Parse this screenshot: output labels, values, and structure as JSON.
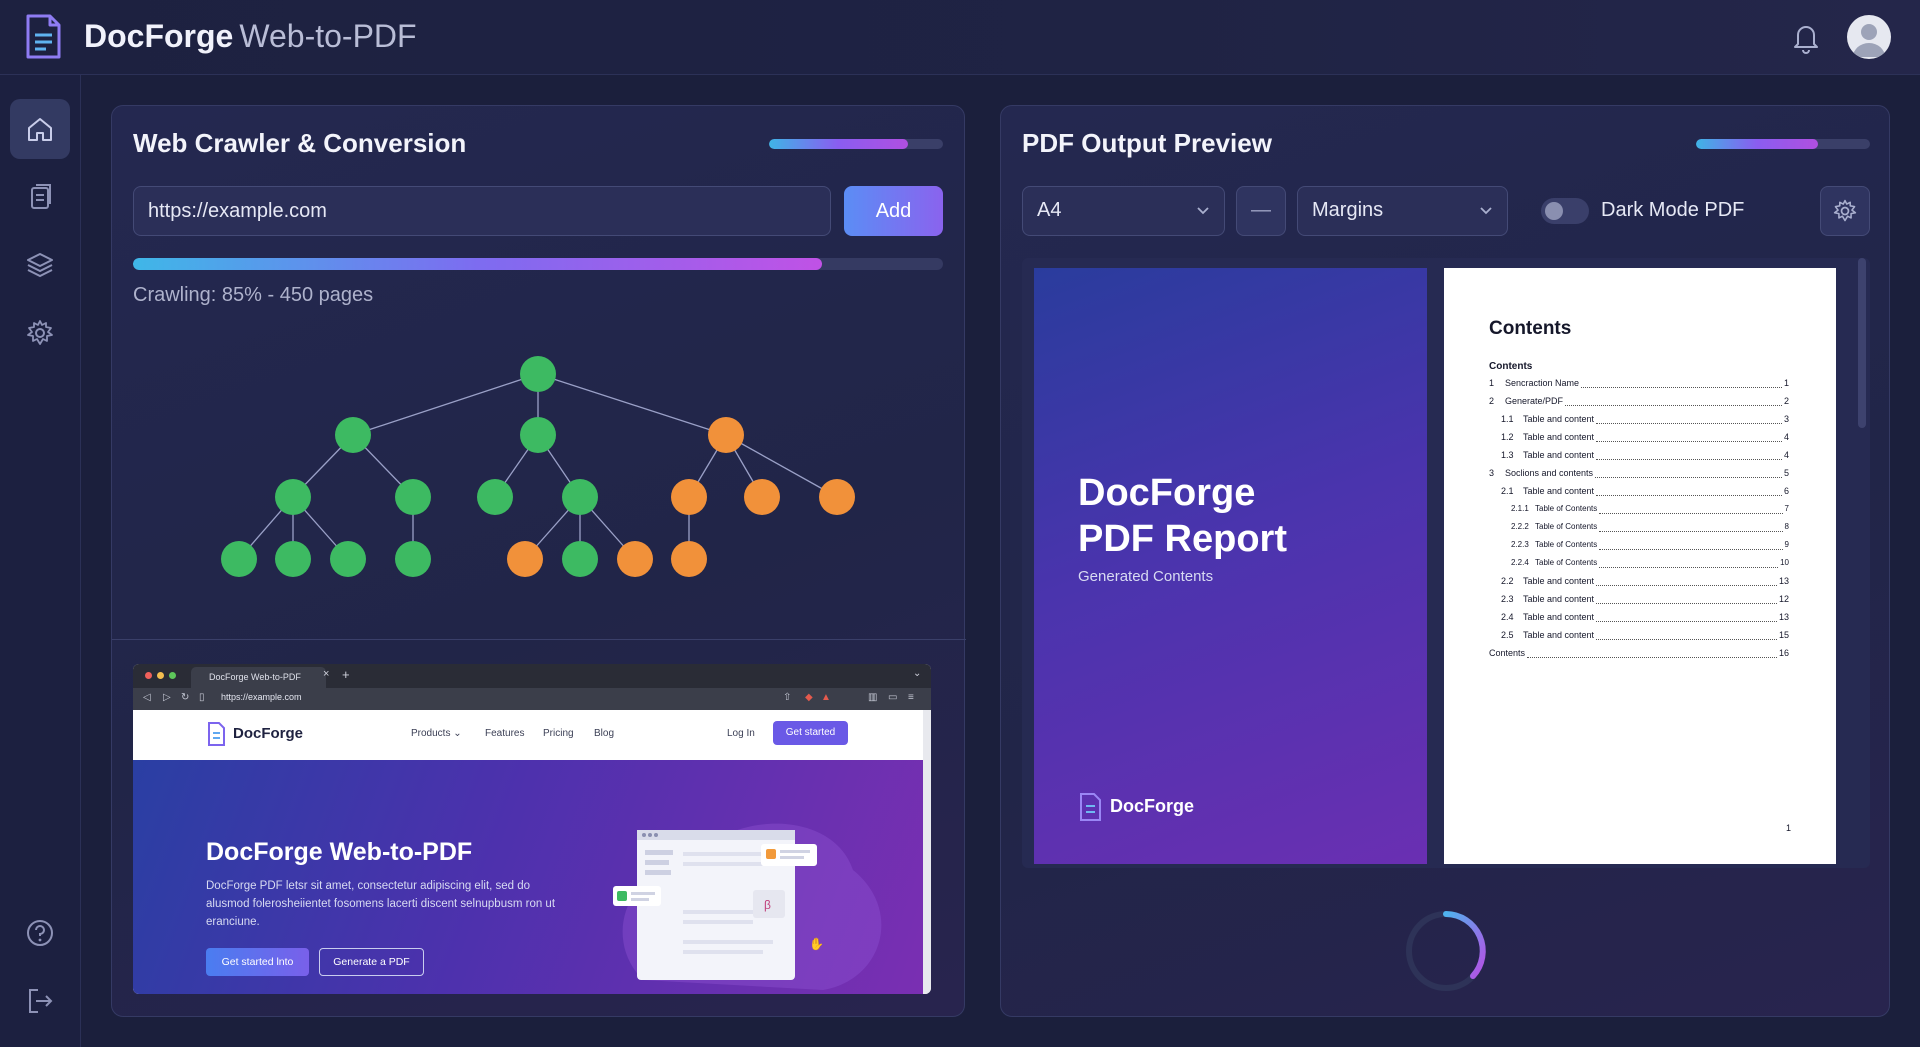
{
  "header": {
    "brand": "DocForge",
    "suffix": "Web-to-PDF"
  },
  "sidebar": {
    "items": [
      {
        "icon": "home-icon",
        "active": true
      },
      {
        "icon": "documents-icon"
      },
      {
        "icon": "layers-icon"
      },
      {
        "icon": "settings-icon"
      },
      {
        "icon": "help-icon"
      },
      {
        "icon": "logout-icon"
      }
    ]
  },
  "crawler": {
    "title": "Web Crawler & Conversion",
    "header_progress": 0.8,
    "url_value": "https://example.com",
    "add_label": "Add",
    "progress": 0.85,
    "status": "Crawling: 85% - 450 pages",
    "tree_colors": {
      "done": "#3dba62",
      "pending": "#f1913a"
    }
  },
  "browser": {
    "tab_title": "DocForge Web-to-PDF",
    "tab_close": "×",
    "tab_new": "+",
    "address": "https://example.com",
    "site_brand": "DocForge",
    "nav_links": [
      "Products ⌄",
      "Features",
      "Pricing",
      "Blog"
    ],
    "login": "Log In",
    "cta": "Get started",
    "hero_title": "DocForge Web-to-PDF",
    "hero_text": "DocForge PDF letsr sit amet, consectetur adipiscing elit, sed do alusmod folerosheiientet fosomens lacerti discent selnupbusm ron ut eranciune.",
    "hero_btn_primary": "Get started lnto",
    "hero_btn_secondary": "Generate a PDF"
  },
  "preview": {
    "title": "PDF Output Preview",
    "header_progress": 0.7,
    "page_size": "A4",
    "dash": "—",
    "margins": "Margins",
    "dark_mode_label": "Dark Mode PDF",
    "dark_mode_on": false,
    "cover_title_1": "DocForge",
    "cover_title_2": "PDF Report",
    "cover_subtitle": "Generated Contents",
    "cover_brand": "DocForge",
    "toc_title": "Contents",
    "toc_sub": "Contents",
    "toc": [
      {
        "num": "1",
        "label": "Sencraction Name",
        "page": "1",
        "level": 0
      },
      {
        "num": "2",
        "label": "Generate/PDF",
        "page": "2",
        "level": 0
      },
      {
        "num": "1.1",
        "label": "Table and content",
        "page": "3",
        "level": 1
      },
      {
        "num": "1.2",
        "label": "Table and content",
        "page": "4",
        "level": 1
      },
      {
        "num": "1.3",
        "label": "Table and content",
        "page": "4",
        "level": 1
      },
      {
        "num": "3",
        "label": "Soclions and contents",
        "page": "5",
        "level": 0
      },
      {
        "num": "2.1",
        "label": "Table and content",
        "page": "6",
        "level": 1
      },
      {
        "num": "2.1.1",
        "label": "Table of Contents",
        "page": "7",
        "level": 2
      },
      {
        "num": "2.2.2",
        "label": "Table of Contents",
        "page": "8",
        "level": 2
      },
      {
        "num": "2.2.3",
        "label": "Table of Contents",
        "page": "9",
        "level": 2
      },
      {
        "num": "2.2.4",
        "label": "Table of Contents",
        "page": "10",
        "level": 2
      },
      {
        "num": "2.2",
        "label": "Table and content",
        "page": "13",
        "level": 1
      },
      {
        "num": "2.3",
        "label": "Table and content",
        "page": "12",
        "level": 1
      },
      {
        "num": "2.4",
        "label": "Table and content",
        "page": "13",
        "level": 1
      },
      {
        "num": "2.5",
        "label": "Table and content",
        "page": "15",
        "level": 1
      },
      {
        "num": "",
        "label": "Contents",
        "page": "16",
        "level": 0
      }
    ],
    "page_number": "1"
  }
}
